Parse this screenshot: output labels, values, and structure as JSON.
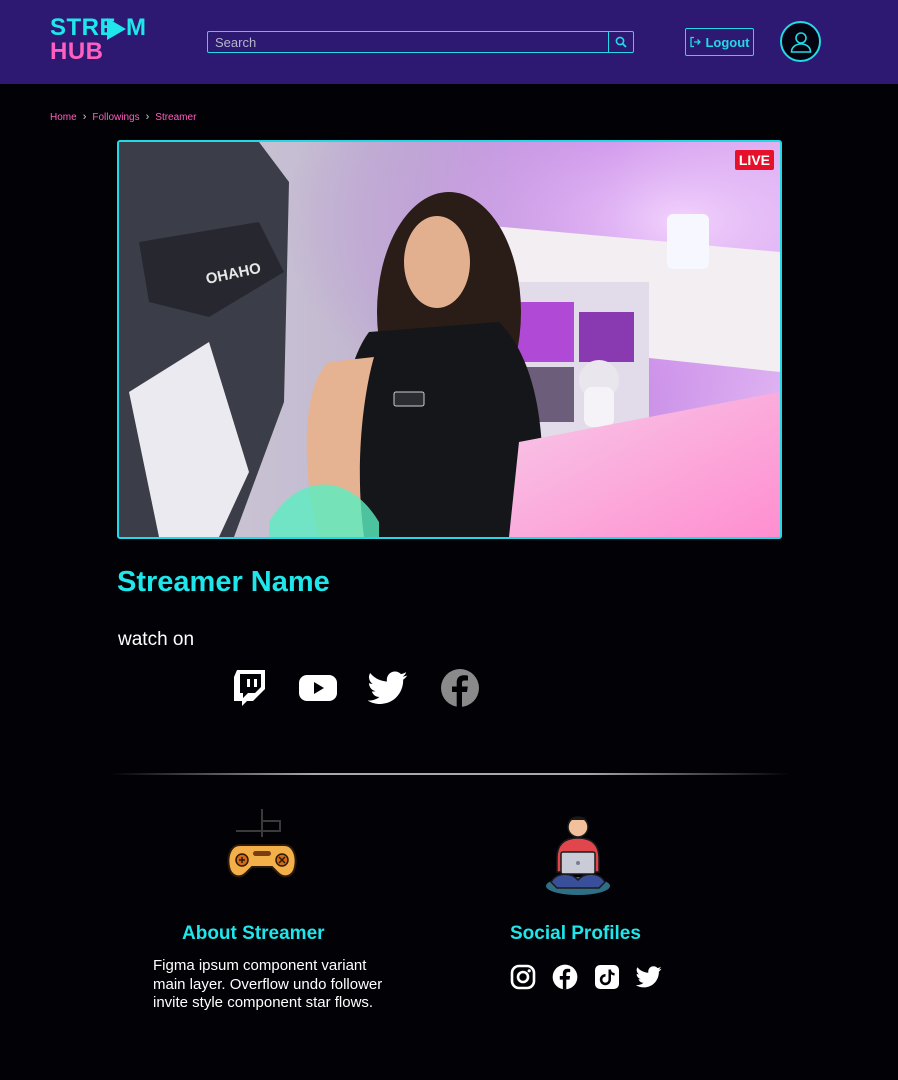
{
  "app": {
    "logo_line1": "STRE",
    "logo_line2": "HUB",
    "logo_tail": "M"
  },
  "header": {
    "search_placeholder": "Search",
    "logout_label": "Logout"
  },
  "breadcrumb": [
    "Home",
    "Followings",
    "Streamer"
  ],
  "stream": {
    "live_badge": "LIVE",
    "streamer_name": "Streamer Name",
    "watch_on_label": "watch on",
    "platforms": [
      "twitch-icon",
      "youtube-icon",
      "twitter-icon",
      "facebook-icon"
    ]
  },
  "about": {
    "title": "About Streamer",
    "text": "Figma ipsum component variant main layer. Overflow undo follower invite style component star flows."
  },
  "social": {
    "title": "Social Profiles",
    "icons": [
      "instagram-icon",
      "facebook-icon",
      "tiktok-icon",
      "twitter-icon"
    ]
  },
  "colors": {
    "header_bg": "#2d1872",
    "accent": "#1ee6ea",
    "pink": "#ff5fbe",
    "background": "#020106",
    "live": "#e6102a"
  }
}
